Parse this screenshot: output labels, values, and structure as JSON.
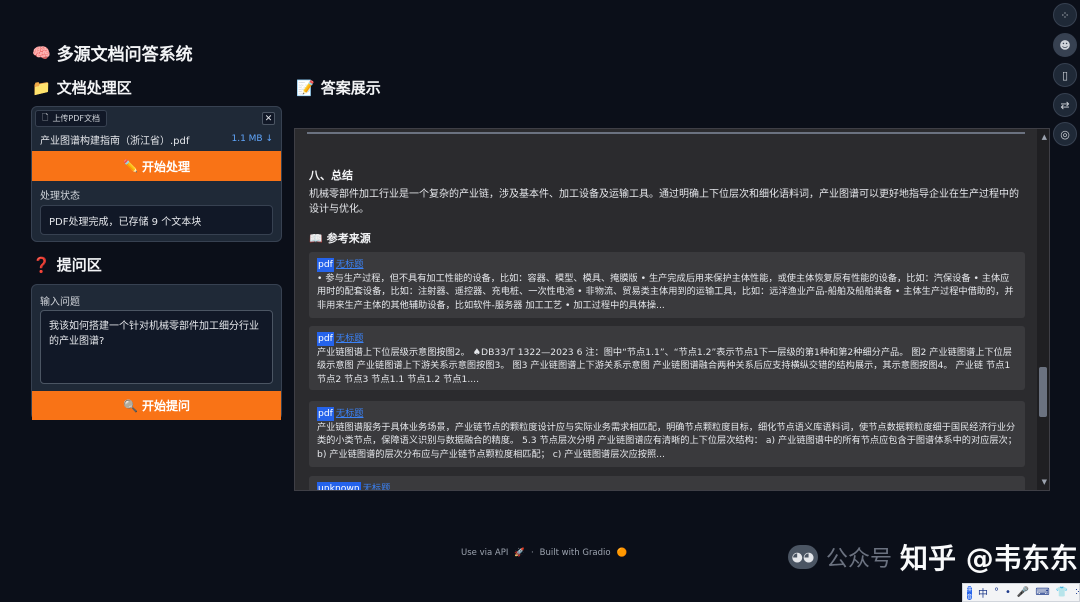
{
  "app": {
    "title": "多源文档问答系统",
    "icon": "brain-icon"
  },
  "doc_section": {
    "title": "文档处理区",
    "icon": "folder-icon",
    "upload_tab": "上传PDF文档",
    "file_name": "产业图谱构建指南（浙江省）.pdf",
    "file_size": "1.1 MB ↓",
    "process_button": "开始处理",
    "status_label": "处理状态",
    "status_value": "PDF处理完成，已存储 9 个文本块"
  },
  "ask_section": {
    "title": "提问区",
    "icon": "question-icon",
    "input_label": "输入问题",
    "question_value": "我该如何搭建一个针对机械零部件加工细分行业的产业图谱?",
    "ask_button": "开始提问"
  },
  "answer_section": {
    "title": "答案展示",
    "icon": "memo-icon",
    "summary_heading": "八、总结",
    "summary_text": "机械零部件加工行业是一个复杂的产业链，涉及基本件、加工设备及运输工具。通过明确上下位层次和细化语料词，产业图谱可以更好地指导企业在生产过程中的设计与优化。",
    "sources_heading": "参考来源",
    "sources": [
      {
        "type": "pdf",
        "link": "无标题",
        "text": "• 参与生产过程，但不具有加工性能的设备，比如：容器、模型、模具、掩膜版 • 生产完成后用来保护主体性能，或使主体恢复原有性能的设备，比如：汽保设备 • 主体应用时的配套设备，比如：注射器、遥控器、充电桩、一次性电池 • 非物流、贸易类主体用到的运输工具，比如：远洋渔业产品-船舶及船舶装备 • 主体生产过程中借助的，并非用来生产主体的其他辅助设备，比如软件-服务器 加工工艺 • 加工过程中的具体操..."
      },
      {
        "type": "pdf",
        "link": "无标题",
        "text": "产业链图谱上下位层级示意图按图2。 ♠DB33/T 1322—2023 6 注：图中“节点1.1”、“节点1.2”表示节点1下一层级的第1种和第2种细分产品。 图2 产业链图谱上下位层级示意图 产业链图谱上下游关系示意图按图3。 图3 产业链图谱上下游关系示意图 产业链图谱融合两种关系后应支持横纵交错的结构展示，其示意图按图4。 产业链 节点1 节点2 节点3 节点1.1 节点1.2 节点1...."
      },
      {
        "type": "pdf",
        "link": "无标题",
        "text": "产业链图谱服务于具体业务场景，产业链节点的颗粒度设计应与实际业务需求相匹配，明确节点颗粒度目标，细化节点语义库语料词，使节点数据颗粒度细于国民经济行业分类的小类节点，保障语义识别与数据融合的精度。 5.3 节点层次分明 产业链图谱应有清晰的上下位层次结构： a) 产业链图谱中的所有节点应包含于图谱体系中的对应层次； b) 产业链图谱的层次分布应与产业链节点颗粒度相匹配； c) 产业链图谱层次应按照..."
      },
      {
        "type": "unknown",
        "link": "无标题",
        "text": ""
      }
    ]
  },
  "footer": {
    "api": "Use via API",
    "built": "Built with Gradio"
  },
  "watermark": {
    "text": "知乎 @韦东东",
    "ghost": "公众号"
  },
  "ime": {
    "logo": "拼音",
    "lang": "中",
    "punct": "°",
    "dots": "•"
  }
}
